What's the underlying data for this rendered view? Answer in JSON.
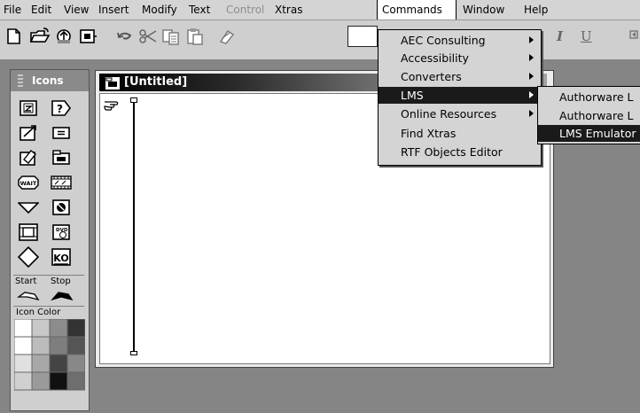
{
  "menubar": {
    "items": [
      {
        "label": "File"
      },
      {
        "label": "Edit"
      },
      {
        "label": "View"
      },
      {
        "label": "Insert"
      },
      {
        "label": "Modify"
      },
      {
        "label": "Text"
      },
      {
        "label": "Control",
        "disabled": true
      },
      {
        "label": "Xtras"
      },
      {
        "label": "Commands",
        "active": true
      },
      {
        "label": "Window"
      },
      {
        "label": "Help"
      }
    ]
  },
  "toolbar": {
    "icons": [
      "new-file-icon",
      "open-file-icon",
      "import-icon",
      "save-icon",
      "undo-icon",
      "cut-icon",
      "copy-icon",
      "paste-icon",
      "format-painter-icon"
    ],
    "text_field_value": "",
    "italic_label": "I",
    "underline_label": "U"
  },
  "palette": {
    "title": "Icons",
    "start_label": "Start",
    "stop_label": "Stop",
    "icon_color_label": "Icon Color",
    "icons": [
      "display-icon",
      "interaction-icon",
      "motion-icon",
      "erase-icon",
      "decision-icon",
      "calculation-icon",
      "wait-icon",
      "navigate-icon",
      "map-icon",
      "framework-icon",
      "digital-movie-icon",
      "sound-icon",
      "video-icon",
      "knowledge-object-icon"
    ],
    "wait_text": "WAIT",
    "ko_text": "KO"
  },
  "document": {
    "title": "[Untitled]"
  },
  "commands_menu": {
    "items": [
      {
        "label": "AEC Consulting",
        "submenu": true
      },
      {
        "label": "Accessibility",
        "submenu": true
      },
      {
        "label": "Converters",
        "submenu": true
      },
      {
        "label": "LMS",
        "submenu": true,
        "selected": true
      },
      {
        "label": "Online Resources",
        "submenu": true
      },
      {
        "label": "Find Xtras",
        "submenu": false
      },
      {
        "label": "RTF Objects Editor",
        "submenu": false
      }
    ]
  },
  "lms_submenu": {
    "items": [
      {
        "label": "Authorware L"
      },
      {
        "label": "Authorware L"
      },
      {
        "label": "LMS Emulator",
        "selected": true
      }
    ]
  },
  "colors": {
    "menubar_bg": "#d4d4d4",
    "workspace_bg": "#858585",
    "selection_bg": "#1a1a1a",
    "disabled_text": "#8e8e8e"
  }
}
